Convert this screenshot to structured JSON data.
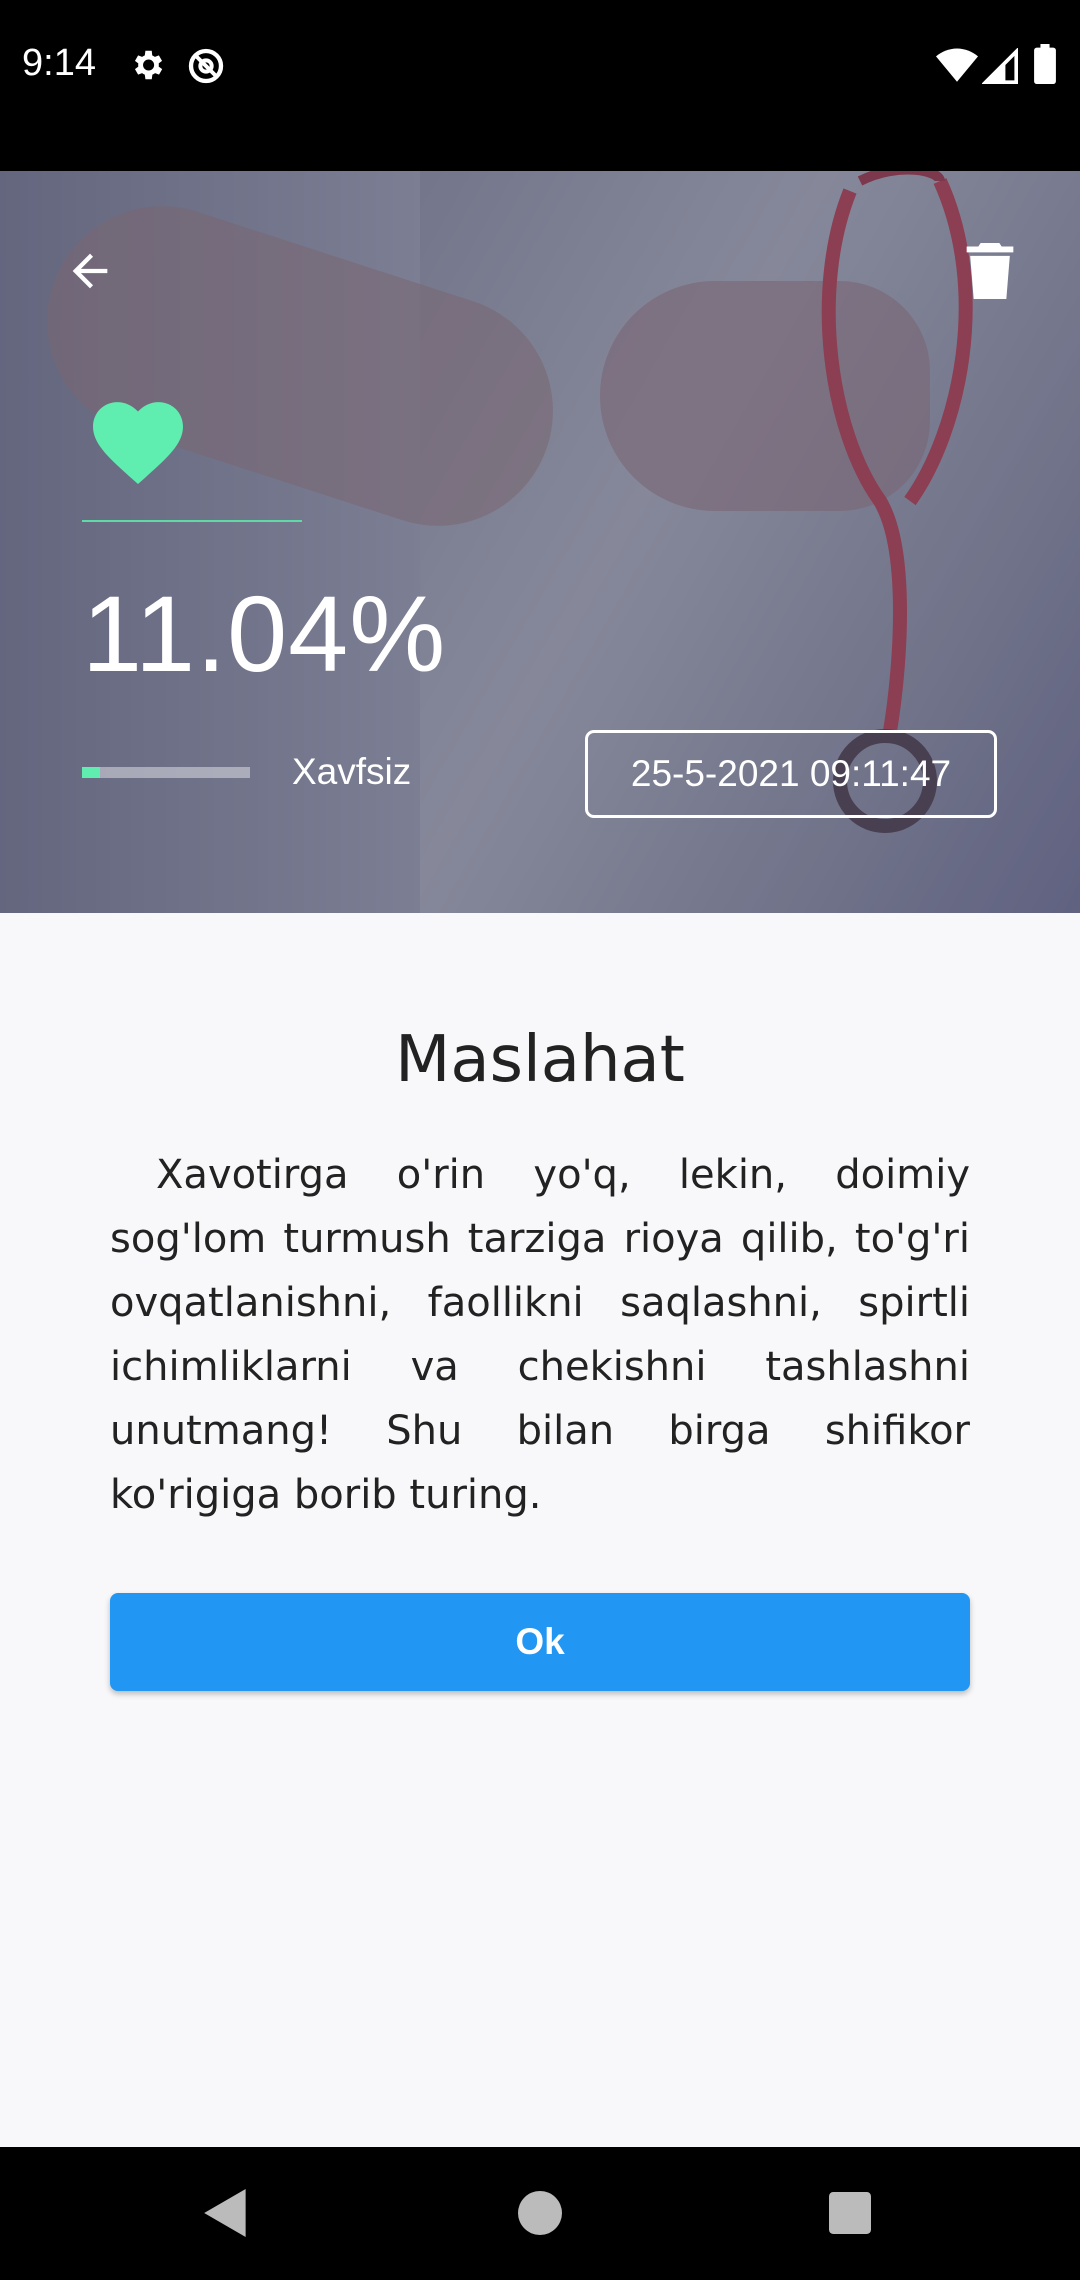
{
  "status_bar": {
    "time": "9:14",
    "icons": [
      "gear-icon",
      "at-sign-icon",
      "wifi-icon",
      "signal-icon",
      "battery-icon"
    ]
  },
  "header": {
    "back_icon": "arrow-left-icon",
    "delete_icon": "trash-icon"
  },
  "result": {
    "heart_icon": "heart-icon",
    "heart_color": "#5fd9a6",
    "percent": "11.04%",
    "risk_level": 0.11,
    "risk_bar_color": "#5fedb0",
    "risk_label": "Xavfsiz",
    "date": "25-5-2021 09:11:47"
  },
  "advice": {
    "title": "Maslahat",
    "body": "Xavotirga o'rin yo'q, lekin, doimiy sog'lom turmush tarziga rioya qilib, to'g'ri ovqatlanishni, faollikni saqlashni, spirtli ichimliklarni va chekishni tashlashni unutmang! Shu bilan birga shifikor ko'rigiga borib turing.",
    "ok_label": "Ok",
    "ok_color": "#2196f3"
  },
  "nav_bar": {
    "icons": [
      "back-triangle-icon",
      "home-circle-icon",
      "recents-square-icon"
    ]
  }
}
